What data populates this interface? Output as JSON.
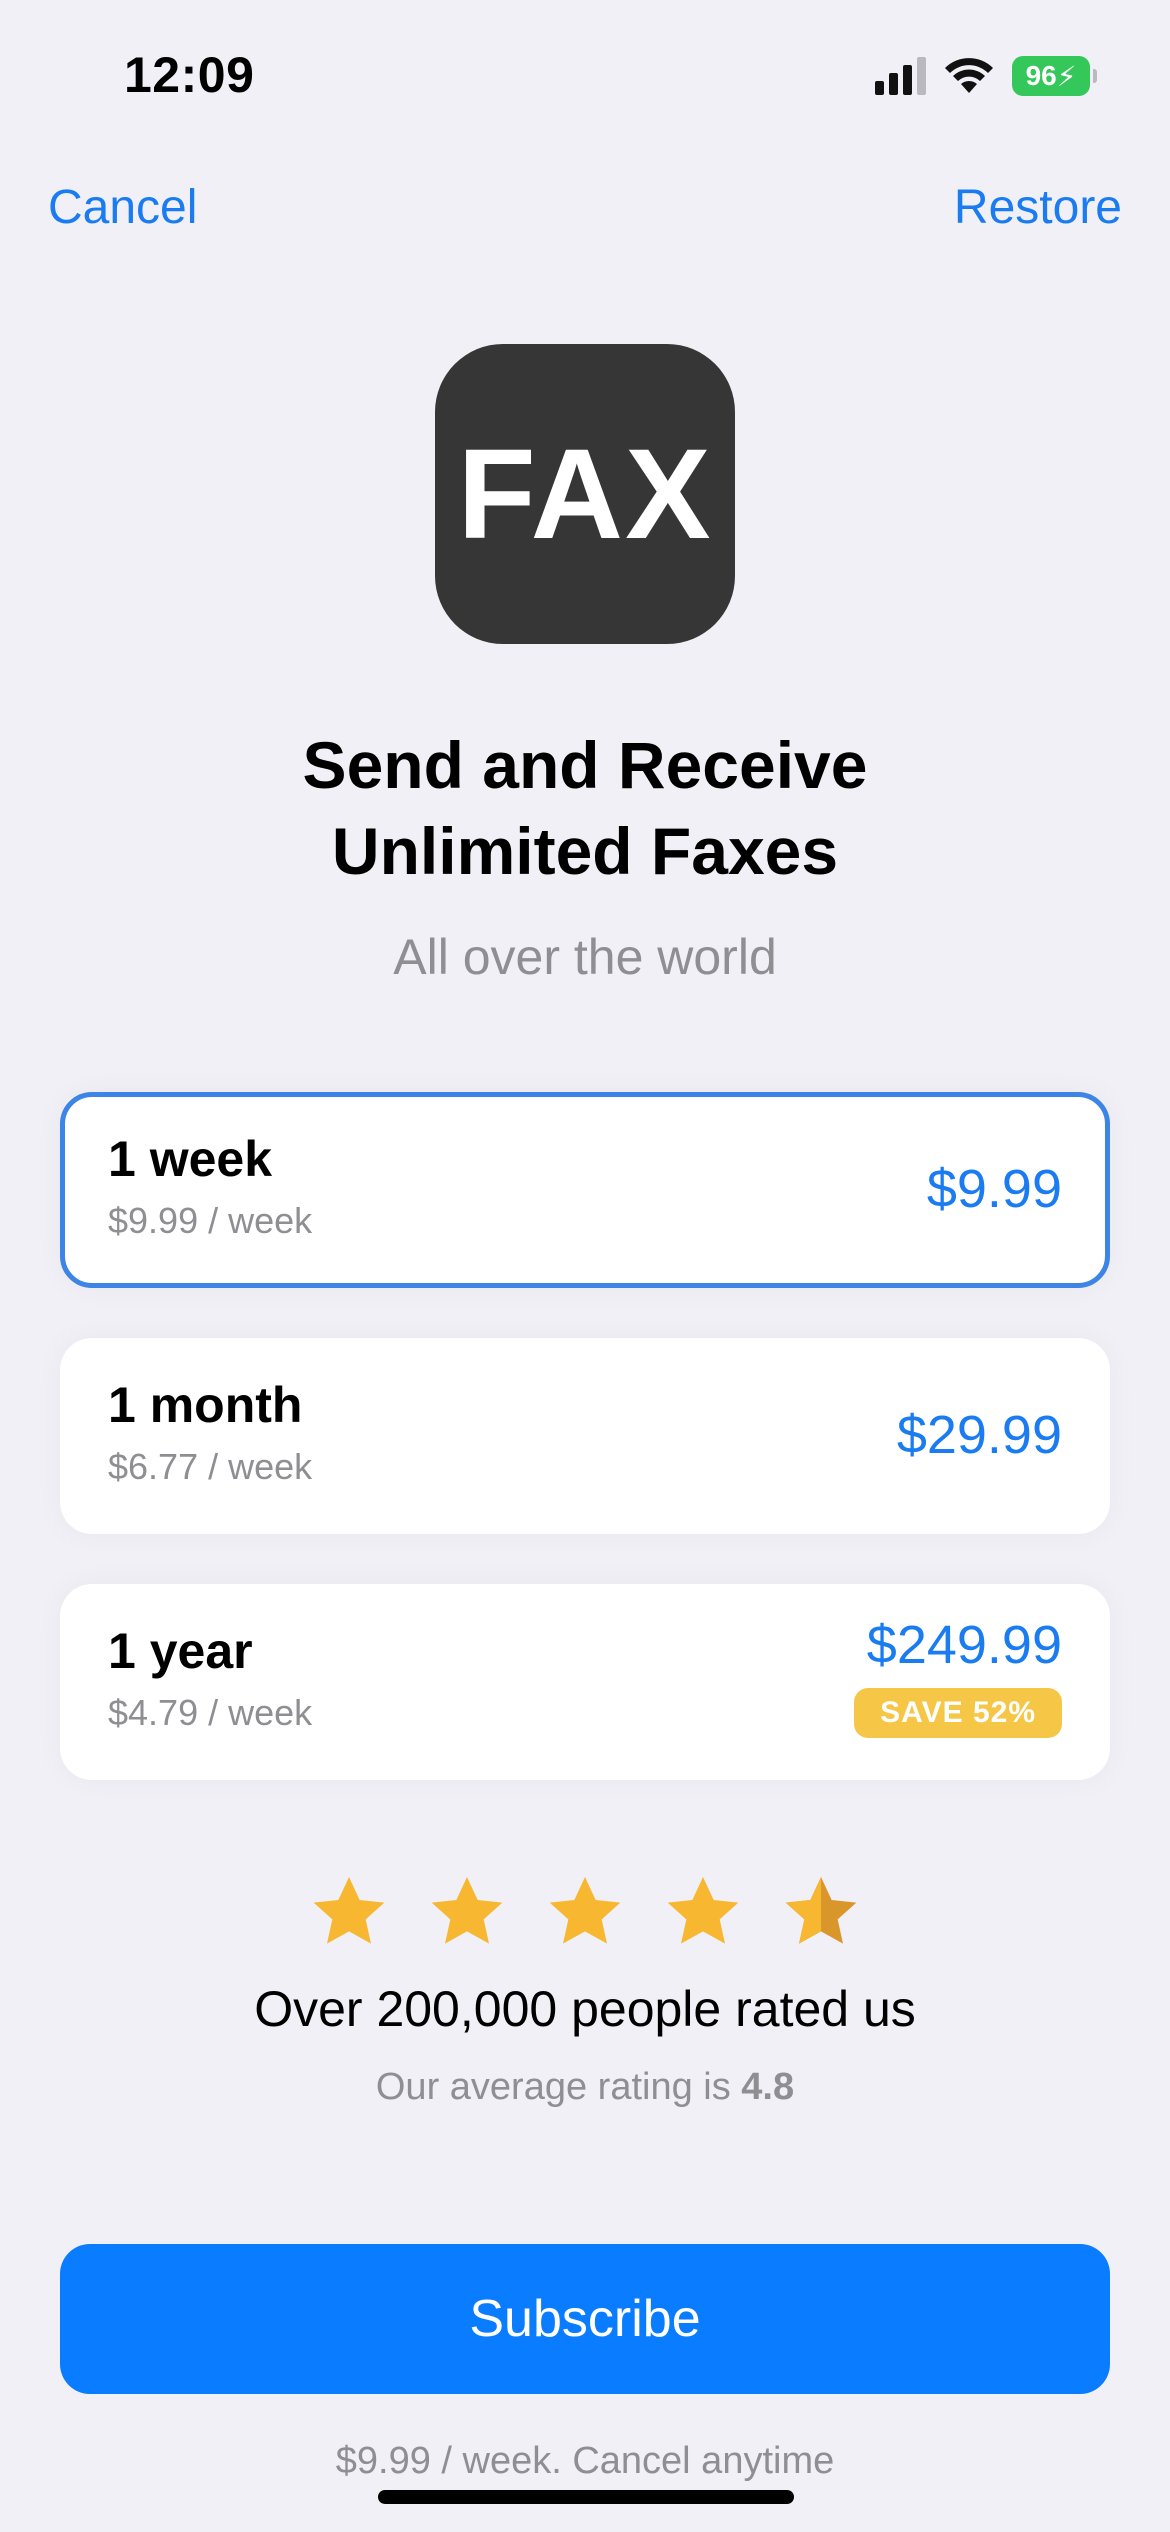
{
  "status_bar": {
    "time": "12:09",
    "battery": "96"
  },
  "nav": {
    "cancel": "Cancel",
    "restore": "Restore"
  },
  "app_icon": {
    "text": "FAX"
  },
  "headline": {
    "line1": "Send and Receive",
    "line2": "Unlimited Faxes"
  },
  "subheadline": "All over the world",
  "plans": [
    {
      "name": "1 week",
      "per_week": "$9.99 / week",
      "price": "$9.99",
      "selected": true
    },
    {
      "name": "1 month",
      "per_week": "$6.77 / week",
      "price": "$29.99",
      "selected": false
    },
    {
      "name": "1 year",
      "per_week": "$4.79 / week",
      "price": "$249.99",
      "badge": "SAVE 52%",
      "selected": false
    }
  ],
  "rating": {
    "stars": 4.5,
    "headline": "Over 200,000 people rated us",
    "average_prefix": "Our average rating is",
    "average_value": "4.8"
  },
  "subscribe_label": "Subscribe",
  "footnote": "$9.99 / week. Cancel anytime",
  "colors": {
    "accent": "#0a7cff",
    "badge": "#f6c646",
    "star": "#f7b731",
    "battery": "#34c759"
  }
}
